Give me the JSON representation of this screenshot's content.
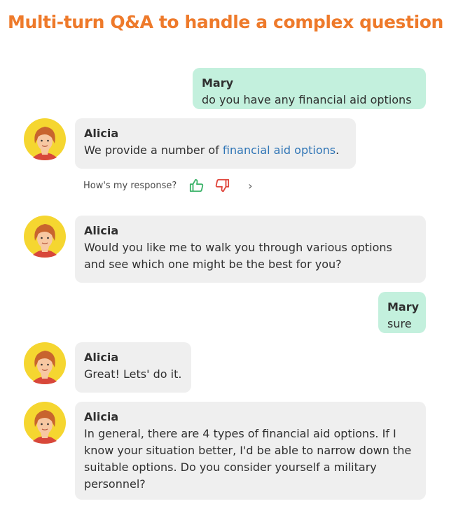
{
  "title": "Multi-turn Q&A to handle a complex question",
  "messages": [
    {
      "sender": "Mary",
      "text": "do you have any financial aid options"
    },
    {
      "sender": "Alicia",
      "text_before": "We provide a number of ",
      "link_text": "financial aid options",
      "text_after": "."
    },
    {
      "sender": "Alicia",
      "text": "Would you like me to walk you through various options and see which one might be the best for you?"
    },
    {
      "sender": "Mary",
      "text": "sure"
    },
    {
      "sender": "Alicia",
      "text": "Great! Lets' do it."
    },
    {
      "sender": "Alicia",
      "text": "In general, there are 4 types of financial aid options. If I know your situation better, I'd be able to narrow down the suitable options. Do you consider yourself a military personnel?"
    }
  ],
  "feedback": {
    "label": "How's my response?",
    "more": "›"
  },
  "colors": {
    "title": "#ee7a2b",
    "user_bubble": "#c3f0dd",
    "bot_bubble": "#efefef",
    "link": "#2e74b5",
    "thumbs_up": "#3db36a",
    "thumbs_down": "#e0463c",
    "avatar_bg": "#f5d630"
  },
  "icons": {
    "avatar": "female-agent-avatar",
    "thumbs_up": "thumbs-up-icon",
    "thumbs_down": "thumbs-down-icon",
    "more": "chevron-right-icon"
  }
}
